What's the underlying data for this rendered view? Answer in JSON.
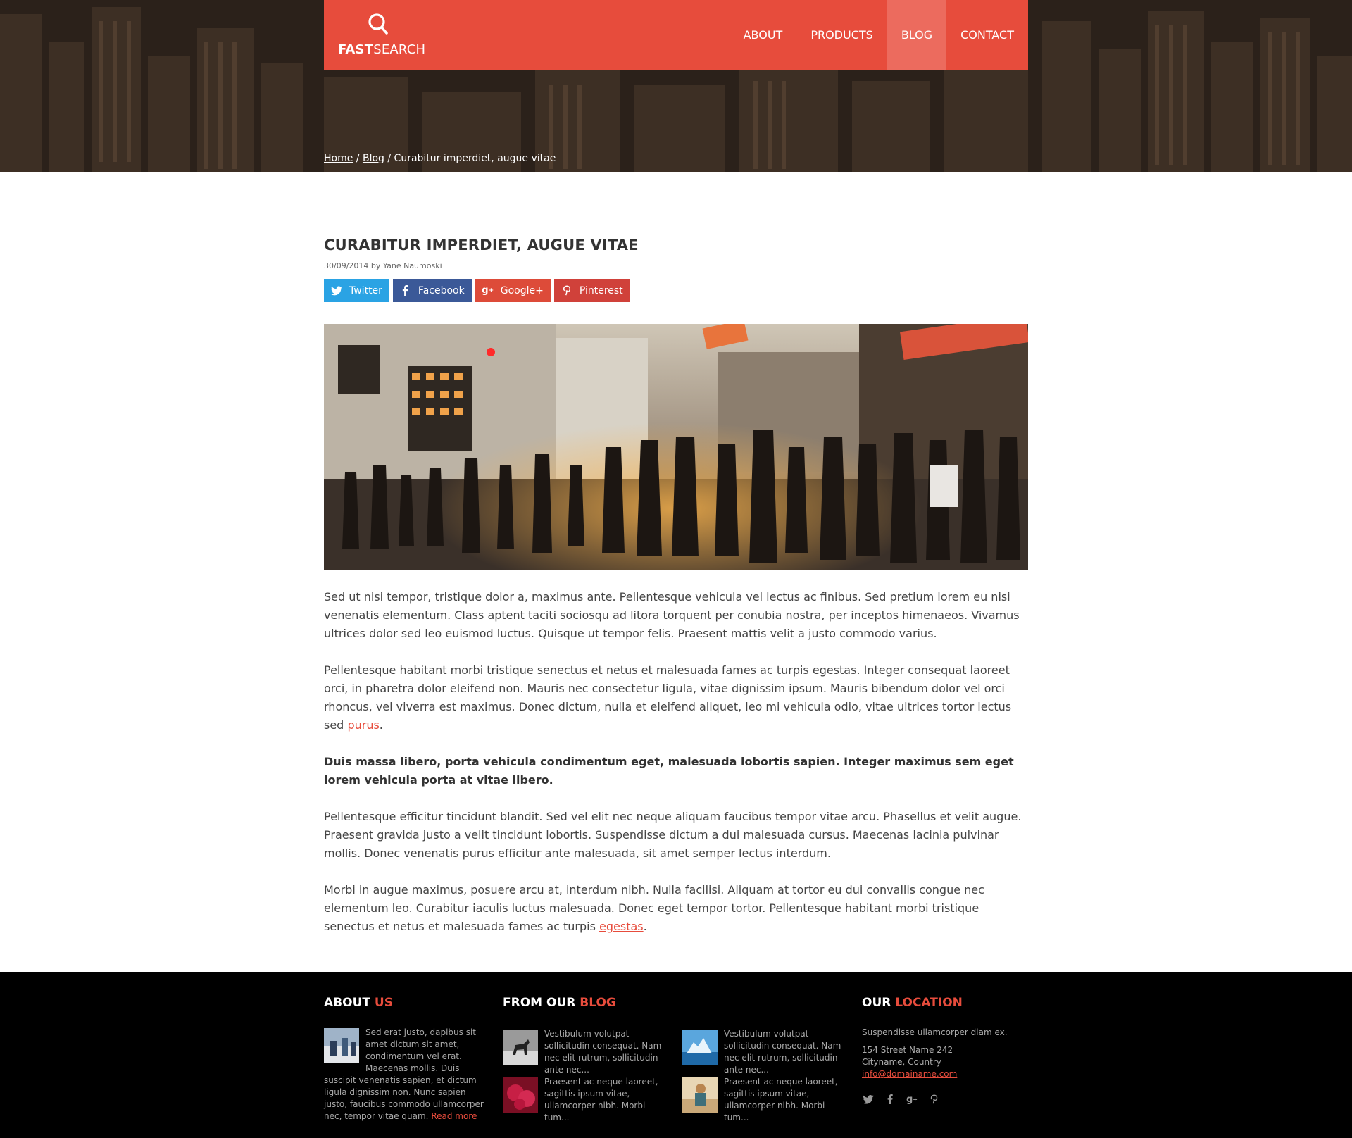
{
  "brand": {
    "logo_bold": "FAST",
    "logo_light": "SEARCH",
    "accent": "#e74c3c"
  },
  "nav": [
    {
      "label": "ABOUT",
      "active": false
    },
    {
      "label": "PRODUCTS",
      "active": false
    },
    {
      "label": "BLOG",
      "active": true
    },
    {
      "label": "CONTACT",
      "active": false
    }
  ],
  "breadcrumb": {
    "home": "Home",
    "sep": "/",
    "blog": "Blog",
    "current": "Curabitur imperdiet, augue vitae"
  },
  "article": {
    "title": "CURABITUR IMPERDIET, AUGUE VITAE",
    "date": "30/09/2014",
    "by": "by",
    "author": "Yane Naumoski",
    "share": {
      "twitter": "Twitter",
      "facebook": "Facebook",
      "google": "Google+",
      "pinterest": "Pinterest"
    },
    "p1": "Sed ut nisi tempor, tristique dolor a, maximus ante. Pellentesque vehicula vel lectus ac finibus. Sed pretium lorem eu nisi venenatis elementum. Class aptent taciti sociosqu ad litora torquent per conubia nostra, per inceptos himenaeos. Vivamus ultrices dolor sed leo euismod luctus. Quisque ut tempor felis. Praesent mattis velit a justo commodo varius.",
    "p2": "Pellentesque habitant morbi tristique senectus et netus et malesuada fames ac turpis egestas. Integer consequat laoreet orci, in pharetra dolor eleifend non. Mauris nec consectetur ligula, vitae dignissim ipsum. Mauris bibendum dolor vel orci rhoncus, vel viverra est maximus. Donec dictum, nulla et eleifend aliquet, leo mi vehicula odio, vitae ultrices tortor lectus sed",
    "p2_link": "purus",
    "p3": "Duis massa libero, porta vehicula condimentum eget, malesuada lobortis sapien. Integer maximus sem eget lorem vehicula porta at vitae libero.",
    "p4": "Pellentesque efficitur tincidunt blandit. Sed vel elit nec neque aliquam faucibus tempor vitae arcu. Phasellus et velit augue. Praesent gravida justo a velit tincidunt lobortis. Suspendisse dictum a dui malesuada cursus. Maecenas lacinia pulvinar mollis. Donec venenatis purus efficitur ante malesuada, sit amet semper lectus interdum.",
    "p5": "Morbi in augue maximus, posuere arcu at, interdum nibh. Nulla facilisi. Aliquam at tortor eu dui convallis congue nec elementum leo. Curabitur iaculis luctus malesuada. Donec eget tempor tortor. Pellentesque habitant morbi tristique senectus et netus et malesuada fames ac turpis",
    "p5_link": "egestas"
  },
  "footer": {
    "about": {
      "head_white": "ABOUT",
      "head_red": "US",
      "text": "Sed erat justo, dapibus sit amet dictum sit amet, condimentum vel erat. Maecenas mollis. Duis suscipit venenatis sapien, et dictum ligula dignissim non. Nunc sapien justo, faucibus commodo ullamcorper nec, tempor vitae quam.",
      "read_more": "Read more"
    },
    "blog": {
      "head_white": "FROM OUR",
      "head_red": "BLOG",
      "items": [
        {
          "text": "Vestibulum volutpat sollicitudin consequat. Nam nec elit rutrum, sollicitudin ante nec...",
          "thumb": "horse-thumb"
        },
        {
          "text": "Vestibulum volutpat sollicitudin consequat. Nam nec elit rutrum, sollicitudin ante nec...",
          "thumb": "iceberg-thumb"
        },
        {
          "text": "Praesent ac neque laoreet, sagittis ipsum vitae, ullamcorper nibh. Morbi tum...",
          "thumb": "raspberry-thumb"
        },
        {
          "text": "Praesent ac neque laoreet, sagittis ipsum vitae, ullamcorper nibh. Morbi tum...",
          "thumb": "beach-thumb"
        }
      ]
    },
    "location": {
      "head_white": "OUR",
      "head_red": "LOCATION",
      "intro": "Suspendisse ullamcorper diam ex.",
      "street": "154 Street Name 242",
      "city": "Cityname, Country",
      "email": "info@domainame.com",
      "socials": [
        "twitter-icon",
        "facebook-icon",
        "google-plus-icon",
        "pinterest-icon"
      ]
    }
  }
}
